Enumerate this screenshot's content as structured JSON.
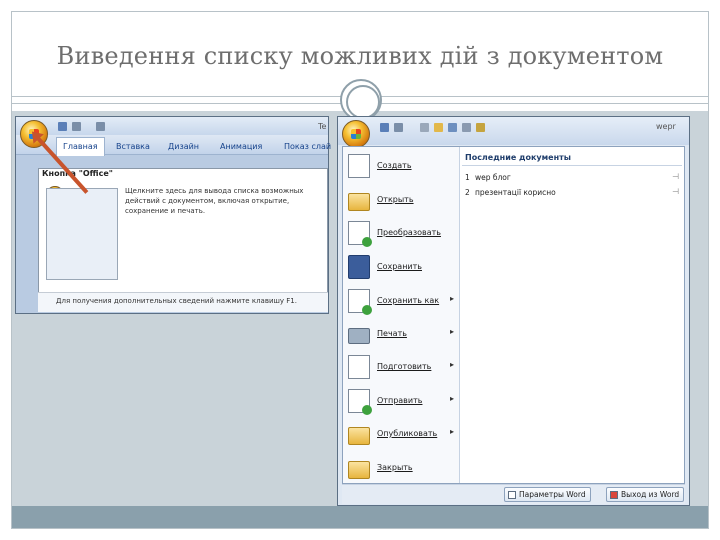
{
  "slide": {
    "title": "Виведення списку можливих дій з документом"
  },
  "colors": {
    "title_text": "#6e6e6e",
    "frame_line": "#b8c2c8",
    "content_bg": "#c9d3d9",
    "bottom_strip": "#8aa0ac",
    "arrow": "#c8542c",
    "office_button": "#f5c033"
  },
  "screenshot_ribbon": {
    "title_fragment": "Te",
    "tabs": [
      "Главная",
      "Вставка",
      "Дизайн",
      "Анимация",
      "Показ слай"
    ],
    "active_tab": "Главная",
    "popup": {
      "title": "Кнопка \"Office\"",
      "description": "Щелкните здесь для вывода списка возможных действий с документом, включая открытие, сохранение и печать.",
      "footer": "Для получения дополнительных сведений нажмите клавишу F1."
    }
  },
  "screenshot_menu": {
    "title_fragment": "wepr",
    "items": [
      {
        "label": "Создать",
        "icon": "new-document-icon",
        "submenu": false
      },
      {
        "label": "Открыть",
        "icon": "open-folder-icon",
        "submenu": false
      },
      {
        "label": "Преобразовать",
        "icon": "convert-icon",
        "submenu": false
      },
      {
        "label": "Сохранить",
        "icon": "save-icon",
        "submenu": false
      },
      {
        "label": "Сохранить как",
        "icon": "save-as-icon",
        "submenu": true
      },
      {
        "label": "Печать",
        "icon": "print-icon",
        "submenu": true
      },
      {
        "label": "Подготовить",
        "icon": "prepare-icon",
        "submenu": true
      },
      {
        "label": "Отправить",
        "icon": "send-icon",
        "submenu": true
      },
      {
        "label": "Опубликовать",
        "icon": "publish-icon",
        "submenu": true
      },
      {
        "label": "Закрыть",
        "icon": "close-folder-icon",
        "submenu": false
      }
    ],
    "recent": {
      "title": "Последние документы",
      "items": [
        {
          "num": "1",
          "name": "wep блог"
        },
        {
          "num": "2",
          "name": "презентації корисно"
        }
      ]
    },
    "footer": {
      "options_label": "Параметры Word",
      "exit_label": "Выход из Word"
    }
  }
}
